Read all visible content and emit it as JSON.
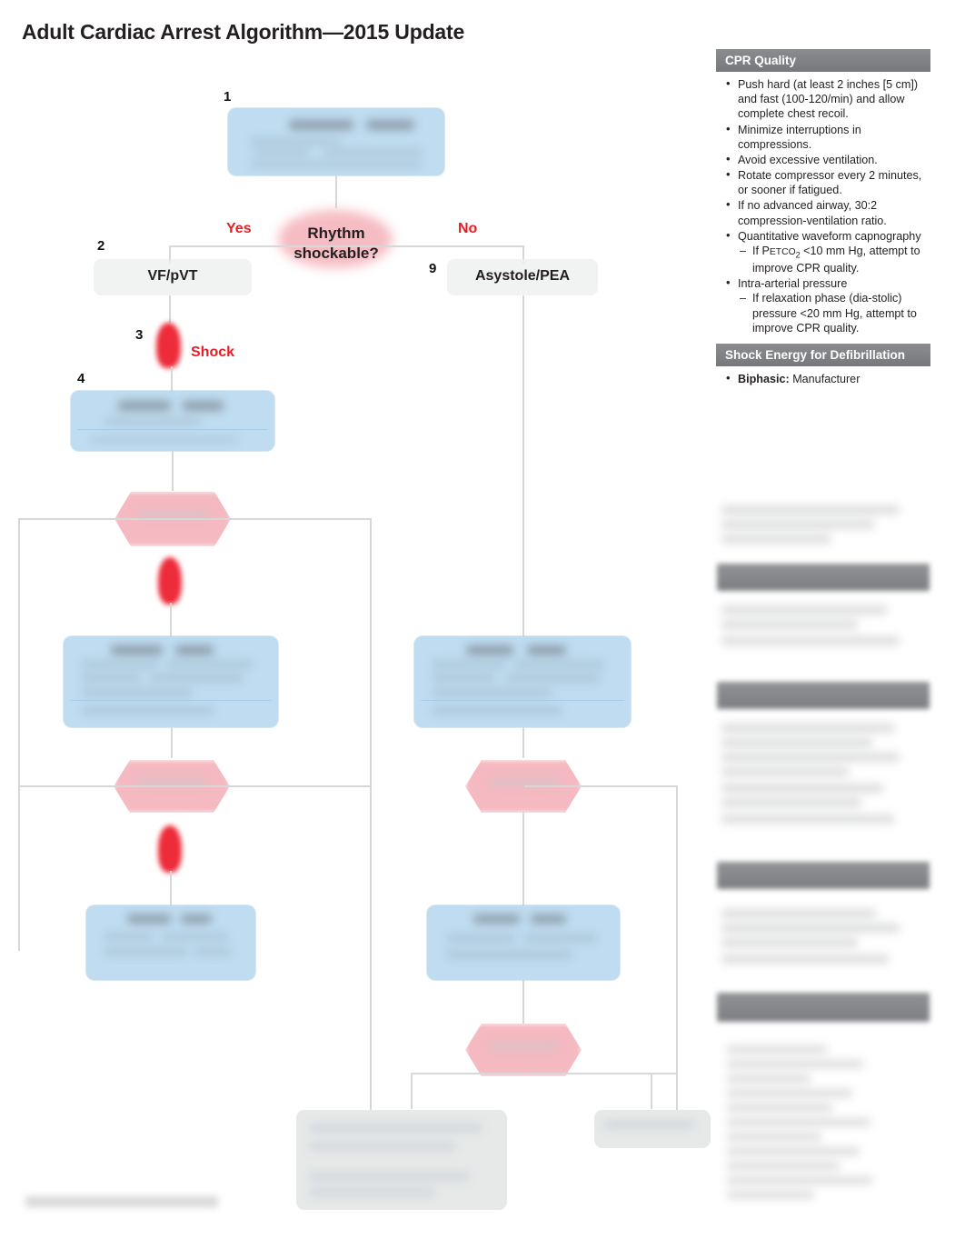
{
  "document": {
    "title": "Adult Cardiac Arrest Algorithm—2015 Update"
  },
  "flowchart": {
    "steps": [
      {
        "num": "1",
        "label": ""
      },
      {
        "num": "2",
        "label": "VF/pVT"
      },
      {
        "num": "3",
        "label": "Shock"
      },
      {
        "num": "4",
        "label": ""
      },
      {
        "num": "9",
        "label": "Asystole/PEA"
      }
    ],
    "decision": {
      "line1": "Rhythm",
      "line2": "shockable?",
      "yes": "Yes",
      "no": "No"
    },
    "colors": {
      "blue_box": "#bfdcf0",
      "pink_decision": "#f4b3bc",
      "red_accent": "#ed1c24",
      "gray_box": "#eceded",
      "connector": "#d7d7d7"
    }
  },
  "sidebar": {
    "sections": [
      {
        "heading": "CPR Quality",
        "heading_visible": true,
        "items": [
          {
            "text": "Push hard (at least 2 inches [5 cm]) and fast (100-120/min) and allow complete chest recoil."
          },
          {
            "text": "Minimize interruptions in compressions."
          },
          {
            "text": "Avoid excessive ventilation."
          },
          {
            "text": "Rotate compressor every 2 minutes, or sooner if fatigued."
          },
          {
            "text": "If no advanced airway, 30:2 compression-ventilation ratio."
          },
          {
            "text": "Quantitative waveform capnography",
            "sub": [
              "If PᴇᴛCO₂ <10 mm Hg, attempt to improve CPR quality."
            ]
          },
          {
            "text": "Intra-arterial pressure",
            "sub": [
              "If relaxation phase (diastolic) pressure <20 mm Hg, attempt to improve CPR quality."
            ]
          }
        ]
      },
      {
        "heading": "Shock Energy for Defibrillation",
        "heading_visible": true,
        "items": [
          {
            "bold": "Biphasic:",
            "text": "Manufacturer"
          }
        ]
      },
      {
        "heading": "",
        "heading_visible": false,
        "items": []
      },
      {
        "heading": "",
        "heading_visible": false,
        "items": []
      },
      {
        "heading": "",
        "heading_visible": false,
        "items": []
      },
      {
        "heading": "",
        "heading_visible": false,
        "items": []
      }
    ]
  }
}
